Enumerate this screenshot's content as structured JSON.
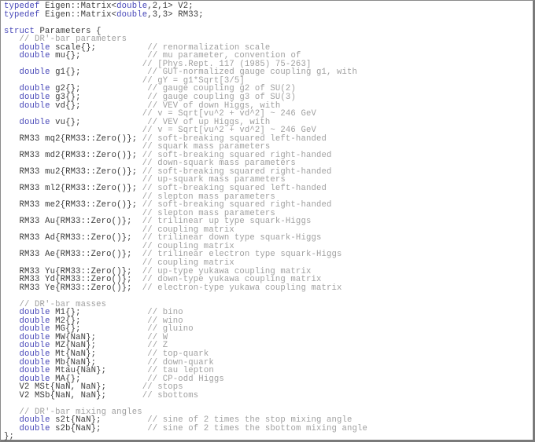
{
  "document": {
    "type": "code-listing",
    "language": "C++",
    "lines": [
      {
        "indent": "",
        "kw": "typedef",
        "code": " Eigen::Matrix<",
        "kw2": "double",
        "code2": ",2,1> V2;",
        "pad": "",
        "comment": ""
      },
      {
        "indent": "",
        "kw": "typedef",
        "code": " Eigen::Matrix<",
        "kw2": "double",
        "code2": ",3,3> RM33;",
        "pad": "",
        "comment": ""
      },
      {
        "indent": "",
        "kw": "",
        "code": "",
        "kw2": "",
        "code2": "",
        "pad": "",
        "comment": ""
      },
      {
        "indent": "",
        "kw": "struct",
        "code": " Parameters {",
        "kw2": "",
        "code2": "",
        "pad": "",
        "comment": ""
      },
      {
        "indent": "   ",
        "kw": "",
        "code": "",
        "kw2": "",
        "code2": "",
        "pad": "",
        "comment": "// DR'-bar parameters"
      },
      {
        "indent": "   ",
        "kw": "double",
        "code": " scale{};",
        "kw2": "",
        "code2": "",
        "pad": "          ",
        "comment": "// renormalization scale"
      },
      {
        "indent": "   ",
        "kw": "double",
        "code": " mu{};",
        "kw2": "",
        "code2": "",
        "pad": "             ",
        "comment": "// mu parameter, convention of"
      },
      {
        "indent": "   ",
        "kw": "",
        "code": "",
        "kw2": "",
        "code2": "",
        "pad": "                        ",
        "comment": "// [Phys.Rept. 117 (1985) 75-263]"
      },
      {
        "indent": "   ",
        "kw": "double",
        "code": " g1{};",
        "kw2": "",
        "code2": "",
        "pad": "             ",
        "comment": "// GUT-normalized gauge coupling g1, with"
      },
      {
        "indent": "   ",
        "kw": "",
        "code": "",
        "kw2": "",
        "code2": "",
        "pad": "                        ",
        "comment": "// gY = g1*Sqrt[3/5]"
      },
      {
        "indent": "   ",
        "kw": "double",
        "code": " g2{};",
        "kw2": "",
        "code2": "",
        "pad": "             ",
        "comment": "// gauge coupling g2 of SU(2)"
      },
      {
        "indent": "   ",
        "kw": "double",
        "code": " g3{};",
        "kw2": "",
        "code2": "",
        "pad": "             ",
        "comment": "// gauge coupling g3 of SU(3)"
      },
      {
        "indent": "   ",
        "kw": "double",
        "code": " vd{};",
        "kw2": "",
        "code2": "",
        "pad": "             ",
        "comment": "// VEV of down Higgs, with"
      },
      {
        "indent": "   ",
        "kw": "",
        "code": "",
        "kw2": "",
        "code2": "",
        "pad": "                        ",
        "comment": "// v = Sqrt[vu^2 + vd^2] ~ 246 GeV"
      },
      {
        "indent": "   ",
        "kw": "double",
        "code": " vu{};",
        "kw2": "",
        "code2": "",
        "pad": "             ",
        "comment": "// VEV of up Higgs, with"
      },
      {
        "indent": "   ",
        "kw": "",
        "code": "",
        "kw2": "",
        "code2": "",
        "pad": "                        ",
        "comment": "// v = Sqrt[vu^2 + vd^2] ~ 246 GeV"
      },
      {
        "indent": "   ",
        "kw": "",
        "code": "RM33 mq2{RM33::Zero()};",
        "kw2": "",
        "code2": "",
        "pad": " ",
        "comment": "// soft-breaking squared left-handed"
      },
      {
        "indent": "   ",
        "kw": "",
        "code": "",
        "kw2": "",
        "code2": "",
        "pad": "                        ",
        "comment": "// squark mass parameters"
      },
      {
        "indent": "   ",
        "kw": "",
        "code": "RM33 md2{RM33::Zero()};",
        "kw2": "",
        "code2": "",
        "pad": " ",
        "comment": "// soft-breaking squared right-handed"
      },
      {
        "indent": "   ",
        "kw": "",
        "code": "",
        "kw2": "",
        "code2": "",
        "pad": "                        ",
        "comment": "// down-squark mass parameters"
      },
      {
        "indent": "   ",
        "kw": "",
        "code": "RM33 mu2{RM33::Zero()};",
        "kw2": "",
        "code2": "",
        "pad": " ",
        "comment": "// soft-breaking squared right-handed"
      },
      {
        "indent": "   ",
        "kw": "",
        "code": "",
        "kw2": "",
        "code2": "",
        "pad": "                        ",
        "comment": "// up-squark mass parameters"
      },
      {
        "indent": "   ",
        "kw": "",
        "code": "RM33 ml2{RM33::Zero()};",
        "kw2": "",
        "code2": "",
        "pad": " ",
        "comment": "// soft-breaking squared left-handed"
      },
      {
        "indent": "   ",
        "kw": "",
        "code": "",
        "kw2": "",
        "code2": "",
        "pad": "                        ",
        "comment": "// slepton mass parameters"
      },
      {
        "indent": "   ",
        "kw": "",
        "code": "RM33 me2{RM33::Zero()};",
        "kw2": "",
        "code2": "",
        "pad": " ",
        "comment": "// soft-breaking squared right-handed"
      },
      {
        "indent": "   ",
        "kw": "",
        "code": "",
        "kw2": "",
        "code2": "",
        "pad": "                        ",
        "comment": "// slepton mass parameters"
      },
      {
        "indent": "   ",
        "kw": "",
        "code": "RM33 Au{RM33::Zero()};",
        "kw2": "",
        "code2": "",
        "pad": "  ",
        "comment": "// trilinear up type squark-Higgs"
      },
      {
        "indent": "   ",
        "kw": "",
        "code": "",
        "kw2": "",
        "code2": "",
        "pad": "                        ",
        "comment": "// coupling matrix"
      },
      {
        "indent": "   ",
        "kw": "",
        "code": "RM33 Ad{RM33::Zero()};",
        "kw2": "",
        "code2": "",
        "pad": "  ",
        "comment": "// trilinear down type squark-Higgs"
      },
      {
        "indent": "   ",
        "kw": "",
        "code": "",
        "kw2": "",
        "code2": "",
        "pad": "                        ",
        "comment": "// coupling matrix"
      },
      {
        "indent": "   ",
        "kw": "",
        "code": "RM33 Ae{RM33::Zero()};",
        "kw2": "",
        "code2": "",
        "pad": "  ",
        "comment": "// trilinear electron type squark-Higgs"
      },
      {
        "indent": "   ",
        "kw": "",
        "code": "",
        "kw2": "",
        "code2": "",
        "pad": "                        ",
        "comment": "// coupling matrix"
      },
      {
        "indent": "   ",
        "kw": "",
        "code": "RM33 Yu{RM33::Zero()};",
        "kw2": "",
        "code2": "",
        "pad": "  ",
        "comment": "// up-type yukawa coupling matrix"
      },
      {
        "indent": "   ",
        "kw": "",
        "code": "RM33 Yd{RM33::Zero()};",
        "kw2": "",
        "code2": "",
        "pad": "  ",
        "comment": "// down-type yukawa coupling matrix"
      },
      {
        "indent": "   ",
        "kw": "",
        "code": "RM33 Ye{RM33::Zero()};",
        "kw2": "",
        "code2": "",
        "pad": "  ",
        "comment": "// electron-type yukawa coupling matrix"
      },
      {
        "indent": "",
        "kw": "",
        "code": "",
        "kw2": "",
        "code2": "",
        "pad": "",
        "comment": ""
      },
      {
        "indent": "   ",
        "kw": "",
        "code": "",
        "kw2": "",
        "code2": "",
        "pad": "",
        "comment": "// DR'-bar masses"
      },
      {
        "indent": "   ",
        "kw": "double",
        "code": " M1{};",
        "kw2": "",
        "code2": "",
        "pad": "             ",
        "comment": "// bino"
      },
      {
        "indent": "   ",
        "kw": "double",
        "code": " M2{};",
        "kw2": "",
        "code2": "",
        "pad": "             ",
        "comment": "// wino"
      },
      {
        "indent": "   ",
        "kw": "double",
        "code": " MG{};",
        "kw2": "",
        "code2": "",
        "pad": "             ",
        "comment": "// gluino"
      },
      {
        "indent": "   ",
        "kw": "double",
        "code": " MW{NaN};",
        "kw2": "",
        "code2": "",
        "pad": "          ",
        "comment": "// W"
      },
      {
        "indent": "   ",
        "kw": "double",
        "code": " MZ{NaN};",
        "kw2": "",
        "code2": "",
        "pad": "          ",
        "comment": "// Z"
      },
      {
        "indent": "   ",
        "kw": "double",
        "code": " Mt{NaN};",
        "kw2": "",
        "code2": "",
        "pad": "          ",
        "comment": "// top-quark"
      },
      {
        "indent": "   ",
        "kw": "double",
        "code": " Mb{NaN};",
        "kw2": "",
        "code2": "",
        "pad": "          ",
        "comment": "// down-quark"
      },
      {
        "indent": "   ",
        "kw": "double",
        "code": " Mtau{NaN};",
        "kw2": "",
        "code2": "",
        "pad": "        ",
        "comment": "// tau lepton"
      },
      {
        "indent": "   ",
        "kw": "double",
        "code": " MA{};",
        "kw2": "",
        "code2": "",
        "pad": "             ",
        "comment": "// CP-odd Higgs"
      },
      {
        "indent": "   ",
        "kw": "",
        "code": "V2 MSt{NaN, NaN};",
        "kw2": "",
        "code2": "",
        "pad": "       ",
        "comment": "// stops"
      },
      {
        "indent": "   ",
        "kw": "",
        "code": "V2 MSb{NaN, NaN};",
        "kw2": "",
        "code2": "",
        "pad": "       ",
        "comment": "// sbottoms"
      },
      {
        "indent": "",
        "kw": "",
        "code": "",
        "kw2": "",
        "code2": "",
        "pad": "",
        "comment": ""
      },
      {
        "indent": "   ",
        "kw": "",
        "code": "",
        "kw2": "",
        "code2": "",
        "pad": "",
        "comment": "// DR'-bar mixing angles"
      },
      {
        "indent": "   ",
        "kw": "double",
        "code": " s2t{NaN};",
        "kw2": "",
        "code2": "",
        "pad": "         ",
        "comment": "// sine of 2 times the stop mixing angle"
      },
      {
        "indent": "   ",
        "kw": "double",
        "code": " s2b{NaN};",
        "kw2": "",
        "code2": "",
        "pad": "         ",
        "comment": "// sine of 2 times the sbottom mixing angle"
      },
      {
        "indent": "",
        "kw": "",
        "code": "};",
        "kw2": "",
        "code2": "",
        "pad": "",
        "comment": ""
      }
    ]
  },
  "colors": {
    "keyword": "#4646b8",
    "code": "#3c3c3c",
    "comment": "#a0a0a0",
    "border": "#7a7a7a"
  }
}
